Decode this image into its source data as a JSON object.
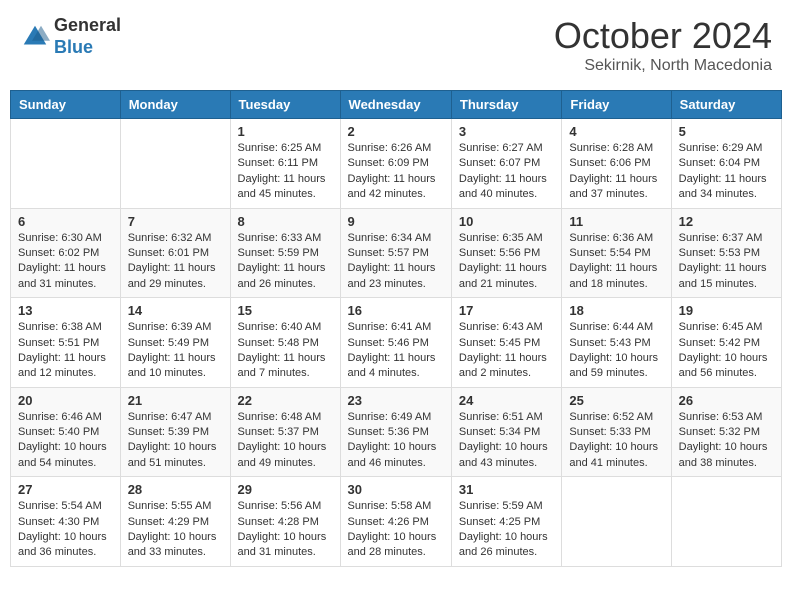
{
  "header": {
    "logo_general": "General",
    "logo_blue": "Blue",
    "month_title": "October 2024",
    "subtitle": "Sekirnik, North Macedonia"
  },
  "weekdays": [
    "Sunday",
    "Monday",
    "Tuesday",
    "Wednesday",
    "Thursday",
    "Friday",
    "Saturday"
  ],
  "weeks": [
    [
      {
        "day": "",
        "info": ""
      },
      {
        "day": "",
        "info": ""
      },
      {
        "day": "1",
        "info": "Sunrise: 6:25 AM\nSunset: 6:11 PM\nDaylight: 11 hours and 45 minutes."
      },
      {
        "day": "2",
        "info": "Sunrise: 6:26 AM\nSunset: 6:09 PM\nDaylight: 11 hours and 42 minutes."
      },
      {
        "day": "3",
        "info": "Sunrise: 6:27 AM\nSunset: 6:07 PM\nDaylight: 11 hours and 40 minutes."
      },
      {
        "day": "4",
        "info": "Sunrise: 6:28 AM\nSunset: 6:06 PM\nDaylight: 11 hours and 37 minutes."
      },
      {
        "day": "5",
        "info": "Sunrise: 6:29 AM\nSunset: 6:04 PM\nDaylight: 11 hours and 34 minutes."
      }
    ],
    [
      {
        "day": "6",
        "info": "Sunrise: 6:30 AM\nSunset: 6:02 PM\nDaylight: 11 hours and 31 minutes."
      },
      {
        "day": "7",
        "info": "Sunrise: 6:32 AM\nSunset: 6:01 PM\nDaylight: 11 hours and 29 minutes."
      },
      {
        "day": "8",
        "info": "Sunrise: 6:33 AM\nSunset: 5:59 PM\nDaylight: 11 hours and 26 minutes."
      },
      {
        "day": "9",
        "info": "Sunrise: 6:34 AM\nSunset: 5:57 PM\nDaylight: 11 hours and 23 minutes."
      },
      {
        "day": "10",
        "info": "Sunrise: 6:35 AM\nSunset: 5:56 PM\nDaylight: 11 hours and 21 minutes."
      },
      {
        "day": "11",
        "info": "Sunrise: 6:36 AM\nSunset: 5:54 PM\nDaylight: 11 hours and 18 minutes."
      },
      {
        "day": "12",
        "info": "Sunrise: 6:37 AM\nSunset: 5:53 PM\nDaylight: 11 hours and 15 minutes."
      }
    ],
    [
      {
        "day": "13",
        "info": "Sunrise: 6:38 AM\nSunset: 5:51 PM\nDaylight: 11 hours and 12 minutes."
      },
      {
        "day": "14",
        "info": "Sunrise: 6:39 AM\nSunset: 5:49 PM\nDaylight: 11 hours and 10 minutes."
      },
      {
        "day": "15",
        "info": "Sunrise: 6:40 AM\nSunset: 5:48 PM\nDaylight: 11 hours and 7 minutes."
      },
      {
        "day": "16",
        "info": "Sunrise: 6:41 AM\nSunset: 5:46 PM\nDaylight: 11 hours and 4 minutes."
      },
      {
        "day": "17",
        "info": "Sunrise: 6:43 AM\nSunset: 5:45 PM\nDaylight: 11 hours and 2 minutes."
      },
      {
        "day": "18",
        "info": "Sunrise: 6:44 AM\nSunset: 5:43 PM\nDaylight: 10 hours and 59 minutes."
      },
      {
        "day": "19",
        "info": "Sunrise: 6:45 AM\nSunset: 5:42 PM\nDaylight: 10 hours and 56 minutes."
      }
    ],
    [
      {
        "day": "20",
        "info": "Sunrise: 6:46 AM\nSunset: 5:40 PM\nDaylight: 10 hours and 54 minutes."
      },
      {
        "day": "21",
        "info": "Sunrise: 6:47 AM\nSunset: 5:39 PM\nDaylight: 10 hours and 51 minutes."
      },
      {
        "day": "22",
        "info": "Sunrise: 6:48 AM\nSunset: 5:37 PM\nDaylight: 10 hours and 49 minutes."
      },
      {
        "day": "23",
        "info": "Sunrise: 6:49 AM\nSunset: 5:36 PM\nDaylight: 10 hours and 46 minutes."
      },
      {
        "day": "24",
        "info": "Sunrise: 6:51 AM\nSunset: 5:34 PM\nDaylight: 10 hours and 43 minutes."
      },
      {
        "day": "25",
        "info": "Sunrise: 6:52 AM\nSunset: 5:33 PM\nDaylight: 10 hours and 41 minutes."
      },
      {
        "day": "26",
        "info": "Sunrise: 6:53 AM\nSunset: 5:32 PM\nDaylight: 10 hours and 38 minutes."
      }
    ],
    [
      {
        "day": "27",
        "info": "Sunrise: 5:54 AM\nSunset: 4:30 PM\nDaylight: 10 hours and 36 minutes."
      },
      {
        "day": "28",
        "info": "Sunrise: 5:55 AM\nSunset: 4:29 PM\nDaylight: 10 hours and 33 minutes."
      },
      {
        "day": "29",
        "info": "Sunrise: 5:56 AM\nSunset: 4:28 PM\nDaylight: 10 hours and 31 minutes."
      },
      {
        "day": "30",
        "info": "Sunrise: 5:58 AM\nSunset: 4:26 PM\nDaylight: 10 hours and 28 minutes."
      },
      {
        "day": "31",
        "info": "Sunrise: 5:59 AM\nSunset: 4:25 PM\nDaylight: 10 hours and 26 minutes."
      },
      {
        "day": "",
        "info": ""
      },
      {
        "day": "",
        "info": ""
      }
    ]
  ]
}
